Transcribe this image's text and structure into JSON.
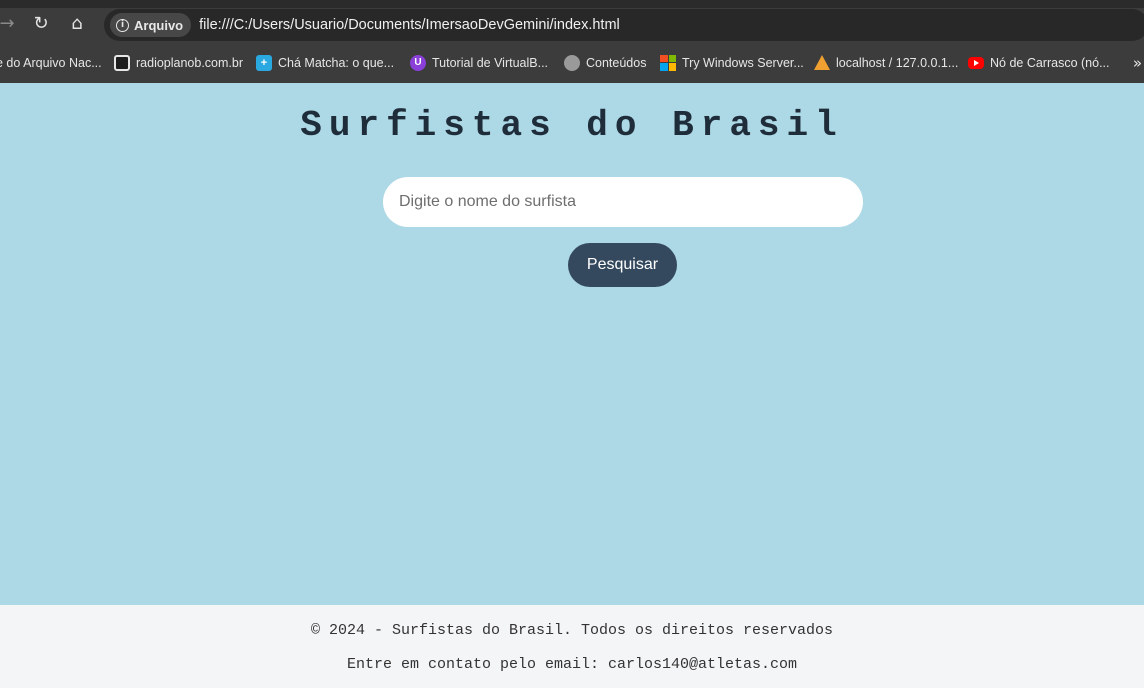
{
  "browser": {
    "security_chip": "Arquivo",
    "url": "file:///C:/Users/Usuario/Documents/ImersaoDevGemini/index.html"
  },
  "bookmarks": [
    {
      "label": "e do Arquivo Nac...",
      "icon": "none"
    },
    {
      "label": "radioplanob.com.br",
      "icon": "radio-icon"
    },
    {
      "label": "Chá Matcha: o que...",
      "icon": "bookmark-icon"
    },
    {
      "label": "Tutorial de VirtualB...",
      "icon": "tutorial-icon"
    },
    {
      "label": "Conteúdos",
      "icon": "globe-icon"
    },
    {
      "label": "Try Windows Server...",
      "icon": "microsoft-icon"
    },
    {
      "label": "localhost / 127.0.0.1...",
      "icon": "phpmyadmin-icon"
    },
    {
      "label": "Nó de Carrasco (nó...",
      "icon": "youtube-icon"
    }
  ],
  "page": {
    "title": "Surfistas do Brasil",
    "search_placeholder": "Digite o nome do surfista",
    "search_button": "Pesquisar"
  },
  "footer": {
    "copyright": "© 2024 - Surfistas do Brasil. Todos os direitos reservados",
    "contact": "Entre em contato pelo email: carlos140@atletas.com"
  },
  "colors": {
    "page_background": "#add8e6",
    "button_background": "#34495e",
    "footer_background": "#f4f5f7"
  }
}
